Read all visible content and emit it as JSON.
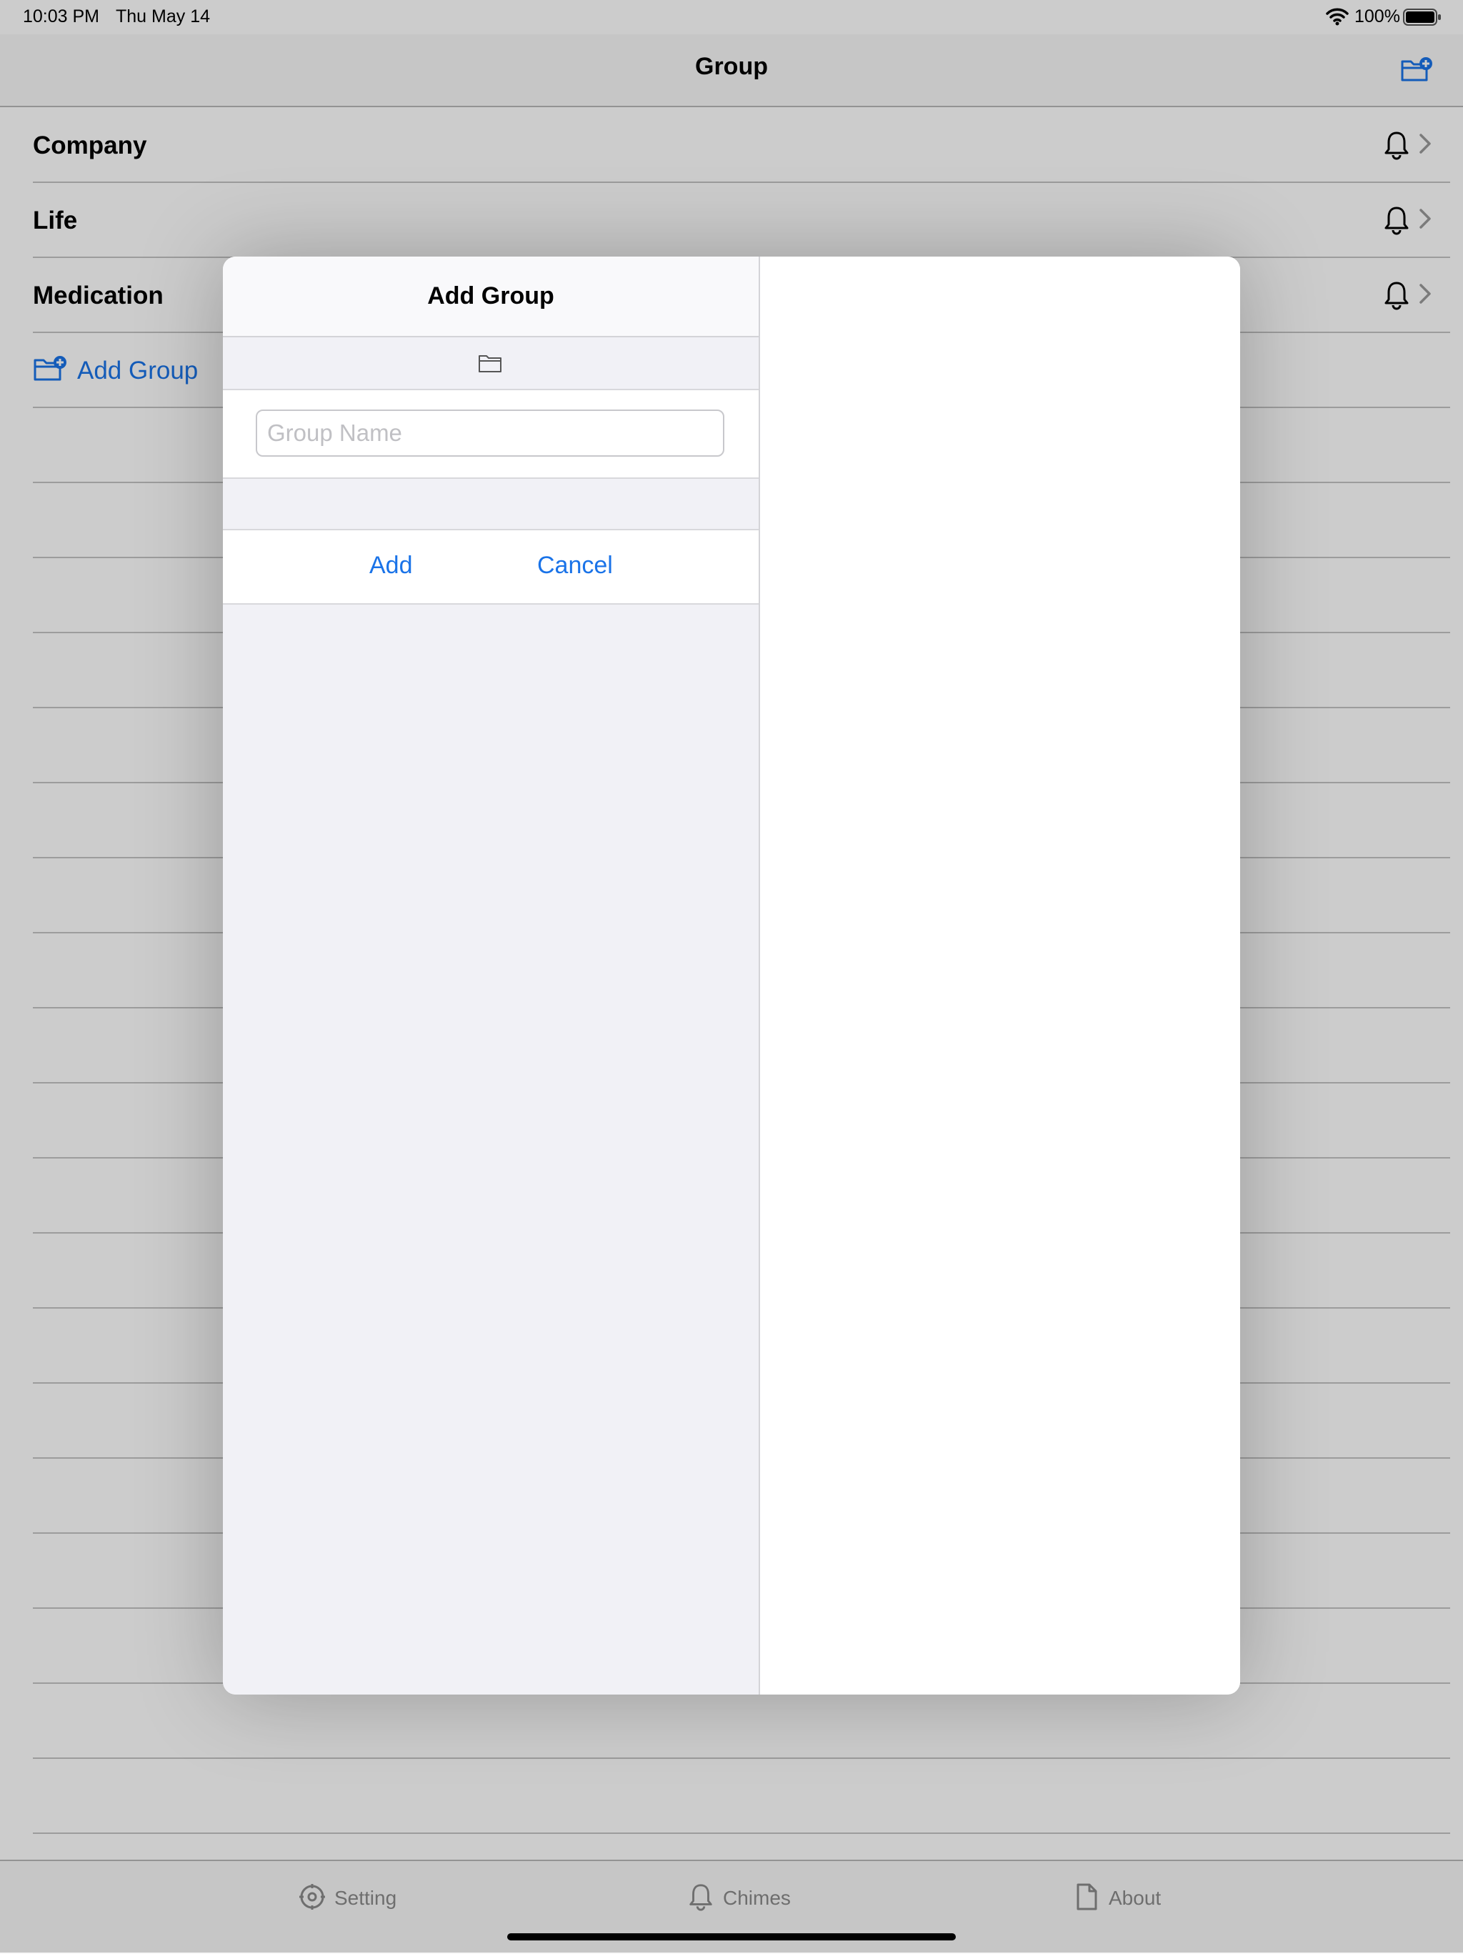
{
  "status_bar": {
    "time": "10:03 PM",
    "date": "Thu May 14",
    "battery": "100%"
  },
  "navbar": {
    "title": "Group"
  },
  "groups": [
    {
      "label": "Company"
    },
    {
      "label": "Life"
    },
    {
      "label": "Medication"
    }
  ],
  "add_group_label": "Add Group",
  "modal": {
    "title": "Add Group",
    "input_placeholder": "Group Name",
    "input_value": "",
    "add_label": "Add",
    "cancel_label": "Cancel"
  },
  "tabs": [
    {
      "label": "Setting",
      "icon": "gear-icon"
    },
    {
      "label": "Chimes",
      "icon": "bell-icon"
    },
    {
      "label": "About",
      "icon": "document-icon"
    }
  ],
  "colors": {
    "accent": "#1a73e8",
    "tab_inactive": "#8a8a8a"
  }
}
